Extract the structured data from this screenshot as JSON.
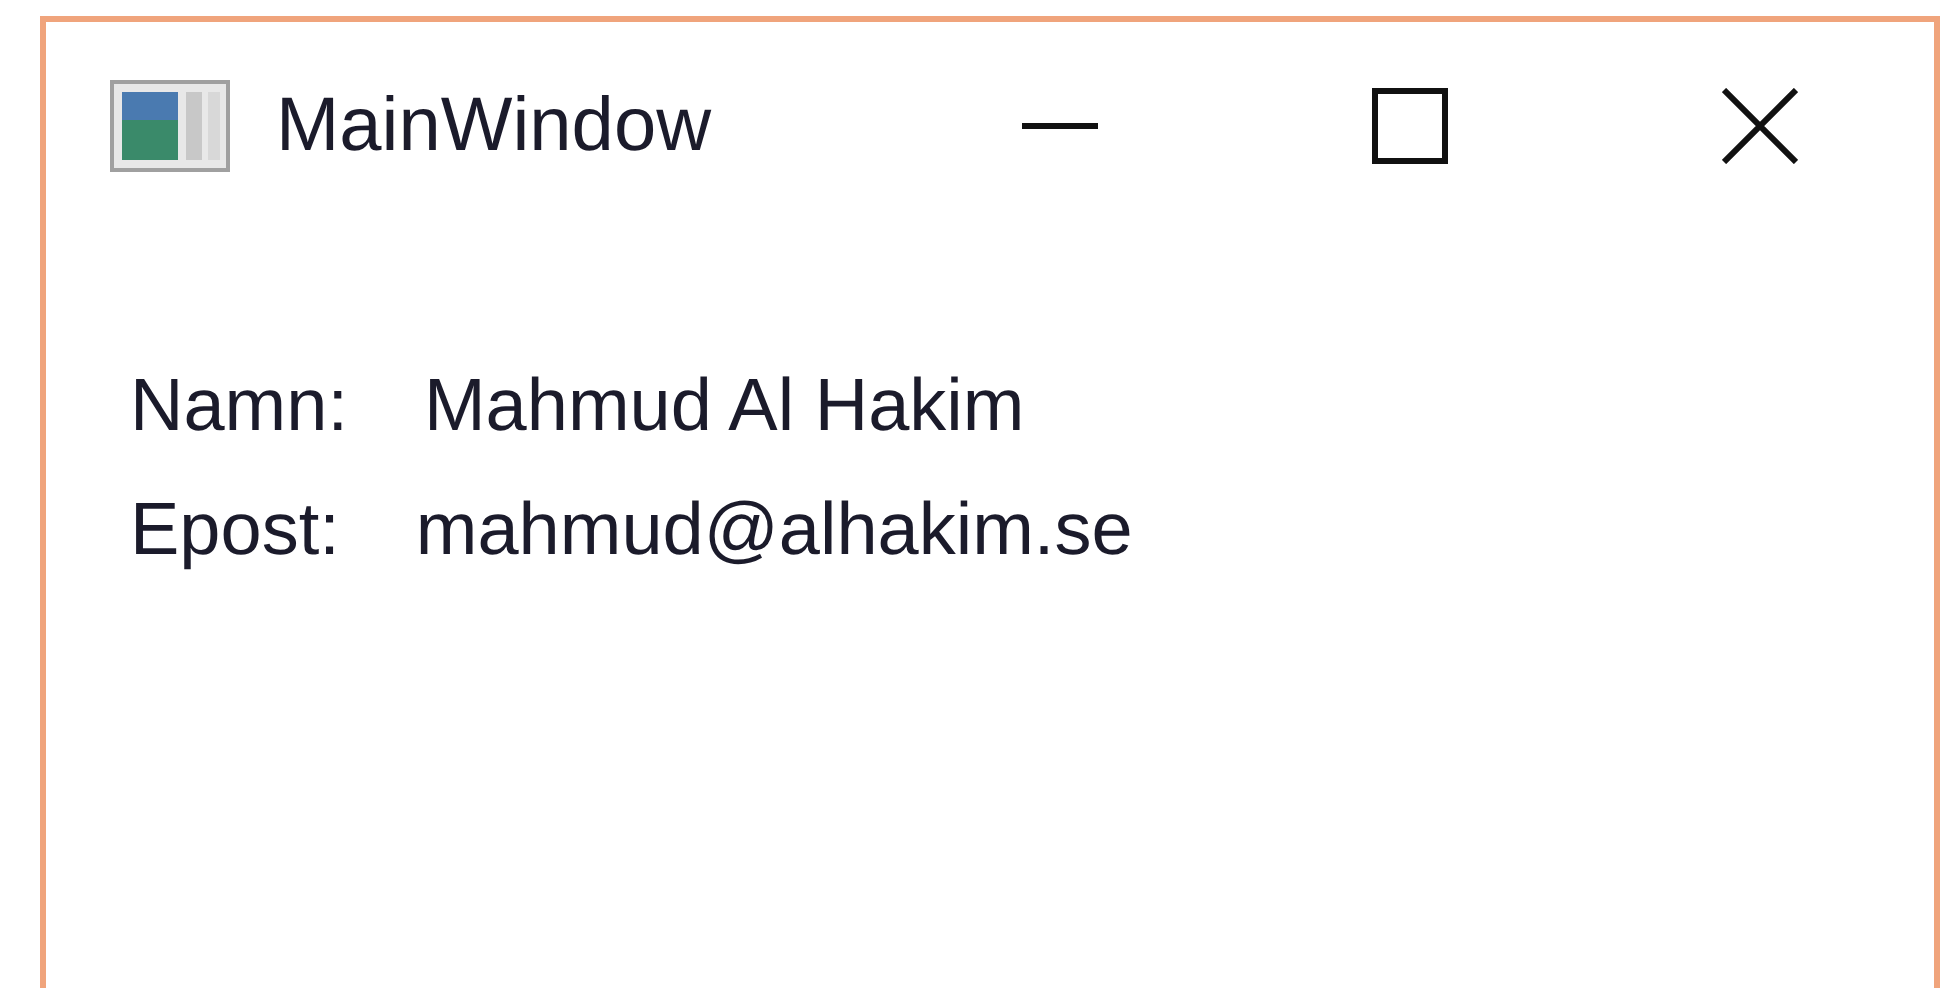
{
  "window": {
    "title": "MainWindow"
  },
  "fields": [
    {
      "label": "Namn:",
      "value": "Mahmud Al Hakim"
    },
    {
      "label": "Epost:",
      "value": "mahmud@alhakim.se"
    }
  ]
}
